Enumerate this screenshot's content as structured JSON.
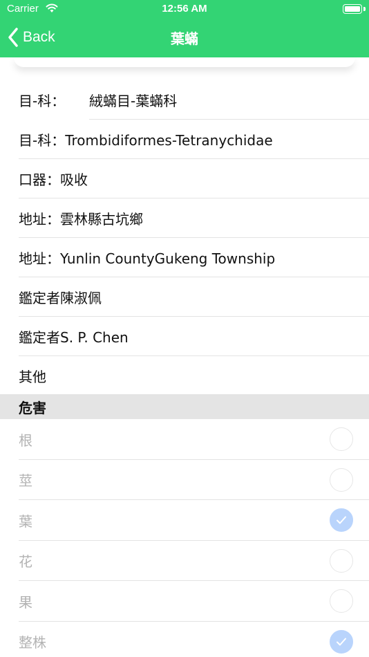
{
  "status_bar": {
    "carrier": "Carrier",
    "time": "12:56 AM"
  },
  "nav": {
    "back_label": "Back",
    "title": "葉蟎"
  },
  "info_rows": {
    "order_family_zh_label": "目-科：",
    "order_family_zh_value": "絨蟎目-葉蟎科",
    "order_family_en": "目-科：Trombidiformes-Tetranychidae",
    "mouthparts": "口器：吸收",
    "address_zh": "地址：雲林縣古坑鄉",
    "address_en": "地址：Yunlin CountyGukeng Township",
    "identifier_zh": "鑑定者陳淑佩",
    "identifier_en": "鑑定者S. P. Chen",
    "other": "其他"
  },
  "section": {
    "title": "危害"
  },
  "hazards": [
    {
      "label": "根",
      "checked": false
    },
    {
      "label": "莖",
      "checked": false
    },
    {
      "label": "葉",
      "checked": true
    },
    {
      "label": "花",
      "checked": false
    },
    {
      "label": "果",
      "checked": false
    },
    {
      "label": "整株",
      "checked": true
    }
  ],
  "colors": {
    "nav_green": "#33d474",
    "check_on": "#b9d4fc",
    "section_bg": "#e4e4e4"
  }
}
